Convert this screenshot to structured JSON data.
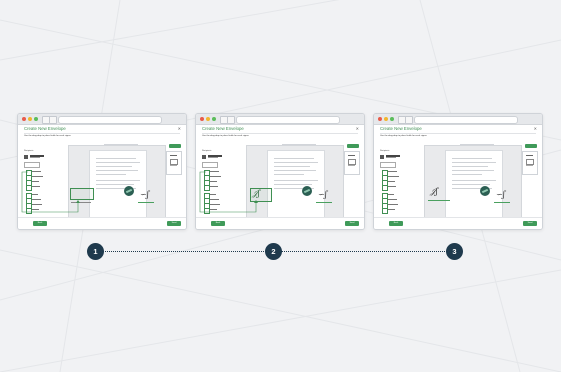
{
  "steps": [
    {
      "number": "1",
      "window_title": "Create New Envelope",
      "instruction": "Use the drag-drop to place fields for each signer",
      "side_label": "Recipients",
      "sidebar_fields": 8,
      "primary_label": "Send",
      "secondary_label": "Back",
      "state": "drag"
    },
    {
      "number": "2",
      "window_title": "Create New Envelope",
      "instruction": "Use the drag-drop to place fields for each signer",
      "side_label": "Recipients",
      "sidebar_fields": 8,
      "primary_label": "Send",
      "secondary_label": "Back",
      "state": "placed"
    },
    {
      "number": "3",
      "window_title": "Create New Envelope",
      "instruction": "Use the drag-drop to place fields for each signer",
      "side_label": "Recipients",
      "sidebar_fields": 8,
      "primary_label": "Send",
      "secondary_label": "Back",
      "state": "signed"
    }
  ],
  "colors": {
    "accent_green": "#3f8f52",
    "step_circle": "#1f3a4d",
    "seal": "#2b5f53"
  }
}
